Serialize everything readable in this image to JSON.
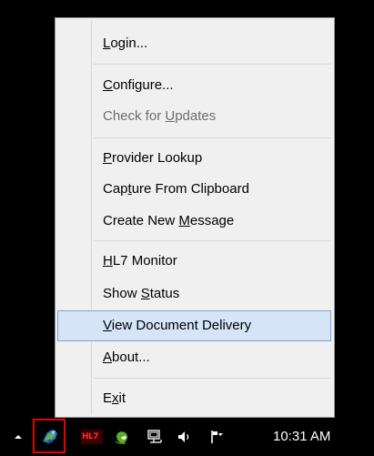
{
  "menu": {
    "items": [
      {
        "pre": "",
        "key": "L",
        "post": "ogin...",
        "enabled": true,
        "highlighted": false
      },
      {
        "pre": "",
        "key": "C",
        "post": "onfigure...",
        "enabled": true,
        "highlighted": false
      },
      {
        "pre": "Check for ",
        "key": "U",
        "post": "pdates",
        "enabled": false,
        "highlighted": false
      },
      {
        "pre": "",
        "key": "P",
        "post": "rovider Lookup",
        "enabled": true,
        "highlighted": false
      },
      {
        "pre": "Cap",
        "key": "t",
        "post": "ure From Clipboard",
        "enabled": true,
        "highlighted": false
      },
      {
        "pre": "Create New ",
        "key": "M",
        "post": "essage",
        "enabled": true,
        "highlighted": false
      },
      {
        "pre": "",
        "key": "H",
        "post": "L7 Monitor",
        "enabled": true,
        "highlighted": false
      },
      {
        "pre": "Show ",
        "key": "S",
        "post": "tatus",
        "enabled": true,
        "highlighted": false
      },
      {
        "pre": "",
        "key": "V",
        "post": "iew Document Delivery",
        "enabled": true,
        "highlighted": true
      },
      {
        "pre": "",
        "key": "A",
        "post": "bout...",
        "enabled": true,
        "highlighted": false
      },
      {
        "pre": "E",
        "key": "x",
        "post": "it",
        "enabled": true,
        "highlighted": false
      }
    ]
  },
  "taskbar": {
    "show_hidden_icon": "chevron-up-icon",
    "tray_icons": [
      {
        "name": "app-tray-icon",
        "selected": true
      },
      {
        "name": "hl7-monitor-icon",
        "label": "HL7"
      },
      {
        "name": "green-app-icon"
      },
      {
        "name": "network-icon"
      },
      {
        "name": "volume-icon"
      },
      {
        "name": "action-center-flag-icon"
      }
    ],
    "clock": "10:31 AM"
  },
  "colors": {
    "menu_background": "#f0f0f0",
    "highlight_fill": "#d5e5f7",
    "highlight_border": "#7ba2d0",
    "disabled_text": "#6d6d6d",
    "selection_outline": "#e60000",
    "taskbar": "#000000"
  }
}
